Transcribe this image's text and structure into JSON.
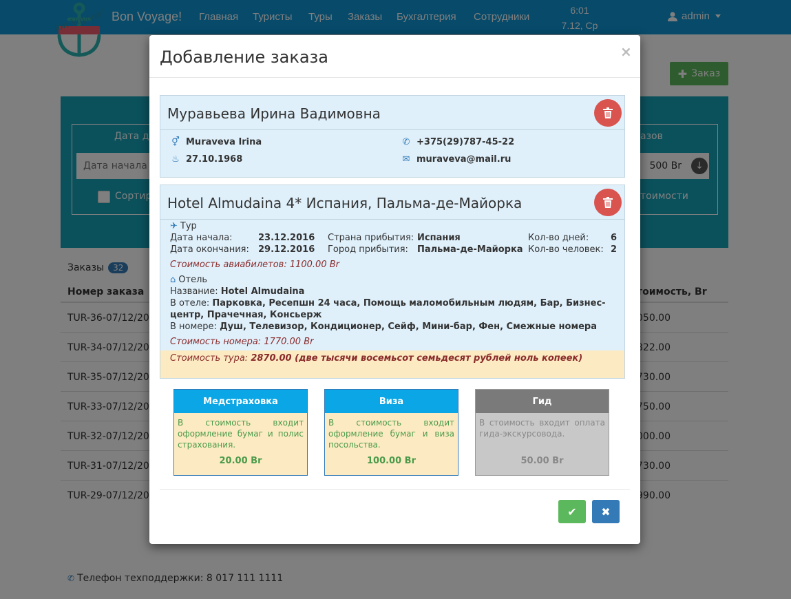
{
  "nav": {
    "brand": "Bon Voyage!",
    "items": [
      "Главная",
      "Туристы",
      "Туры",
      "Заказы",
      "Бухгалтерия",
      "Сотрудники"
    ],
    "clock_time": "6:01",
    "clock_date": "7.12, Ср",
    "user": "admin",
    "logo_text": "Bon Voyage!"
  },
  "page": {
    "add_label": "Заказ",
    "filter": {
      "date_label": "Дата до",
      "date_placeholder": "Дата начала",
      "orders_label": "азов",
      "cost_value": "500 Br",
      "sort_label": "Сортир",
      "cost_label": "тоимости"
    },
    "orders_title": "Заказы",
    "orders_count": "32",
    "col_order": "Номер заказа",
    "col_cost": "тоимость, Br",
    "rows": [
      {
        "order": "TUR-36-07/12/2016",
        "cost": "050.00"
      },
      {
        "order": "TUR-34-07/12/2016",
        "cost": "822.00"
      },
      {
        "order": "TUR-35-07/12/2016",
        "cost": "730.00"
      },
      {
        "order": "TUR-33-07/12/2016",
        "cost": "750.00"
      },
      {
        "order": "TUR-32-07/12/2016",
        "cost": "000.00"
      },
      {
        "order": "TUR-31-07/12/2016",
        "cost": "730.00"
      },
      {
        "order": "TUR-29-07/12/2016",
        "cost": "990.00"
      }
    ],
    "support": "Телефон техподдержки: 8 017 111 1111"
  },
  "modal": {
    "title": "Добавление заказа",
    "close": "×",
    "tourist": {
      "name": "Муравьева Ирина Вадимовна",
      "latin": "Muraveva Irina",
      "birth": "27.10.1968",
      "phone": "+375(29)787-45-22",
      "email": "muraveva@mail.ru"
    },
    "hotel_card": {
      "title": "Hotel Almudaina 4* Испания, Пальма-де-Майорка",
      "tour_label": "Тур",
      "start_label": "Дата начала:",
      "start": "23.12.2016",
      "end_label": "Дата окончания:",
      "end": "29.12.2016",
      "country_label": "Страна прибытия:",
      "country": "Испания",
      "city_label": "Город прибытия:",
      "city": "Пальма-де-Майорка",
      "days_label": "Кол-во дней:",
      "days": "6",
      "people_label": "Кол-во человек:",
      "people": "2",
      "flight_cost": "Стоимость авиабилетов: 1100.00 Br",
      "hotel_label": "Отель",
      "name_label": "Название:",
      "name": "Hotel Almudaina",
      "in_hotel_label": "В отеле:",
      "in_hotel_1": "Парковка, Ресепшн 24 часа, Помощь маломобильным людям, Бар, Бизнес-",
      "in_hotel_2": "центр, Прачечная, Консьерж",
      "in_room_label": "В номере:",
      "in_room": "Душ, Телевизор, Кондиционер, Сейф, Мини-бар, Фен, Смежные номера",
      "room_cost": "Стоимость номера: 1770.00 Br",
      "total_label": "Стоимость тура:",
      "total_value": "2870.00 (две тысячи восемьсот семьдесят рублей ноль копеек)"
    },
    "services": [
      {
        "title": "Медстраховка",
        "desc": "В стоимость входит оформление бумаг и полис страхования.",
        "price": "20.00 Br",
        "color": "#0aa6e6"
      },
      {
        "title": "Виза",
        "desc": "В стоимость входит оформление бумаг и виза посольства.",
        "price": "100.00 Br",
        "color": "#0aa6e6"
      },
      {
        "title": "Гид",
        "desc": "В стоимость входит оплата гида-экскурсовода.",
        "price": "50.00 Br",
        "color": "#7a7a7a"
      }
    ]
  }
}
